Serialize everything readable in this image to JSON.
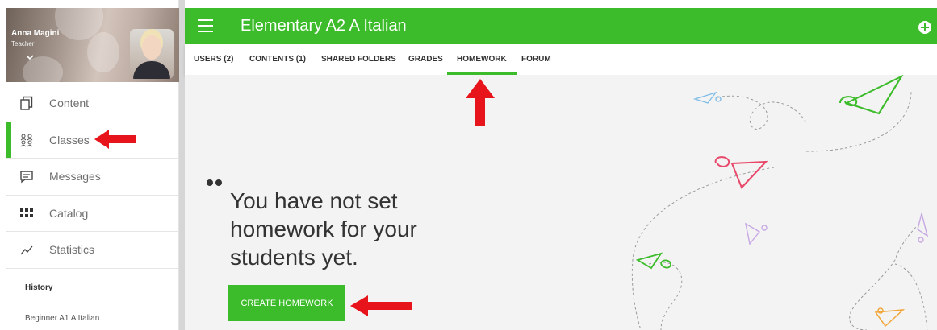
{
  "profile": {
    "name": "Anna Magini",
    "role": "Teacher"
  },
  "sidebar": {
    "items": [
      {
        "label": "Content",
        "icon": "content-icon",
        "active": false
      },
      {
        "label": "Classes",
        "icon": "classes-icon",
        "active": true
      },
      {
        "label": "Messages",
        "icon": "messages-icon",
        "active": false
      },
      {
        "label": "Catalog",
        "icon": "catalog-icon",
        "active": false
      },
      {
        "label": "Statistics",
        "icon": "statistics-icon",
        "active": false
      }
    ],
    "history_title": "History",
    "history_items": [
      "Beginner A1 A Italian"
    ]
  },
  "header": {
    "title": "Elementary A2 A Italian",
    "menu_icon": "hamburger-icon",
    "add_icon": "plus-circle-icon"
  },
  "tabs": [
    {
      "label": "USERS (2)",
      "active": false
    },
    {
      "label": "CONTENTS (1)",
      "active": false
    },
    {
      "label": "SHARED FOLDERS",
      "active": false
    },
    {
      "label": "GRADES",
      "active": false
    },
    {
      "label": "HOMEWORK",
      "active": true
    },
    {
      "label": "FORUM",
      "active": false
    }
  ],
  "main": {
    "empty_message": "You have not set homework for your students yet.",
    "create_button": "CREATE HOMEWORK"
  },
  "colors": {
    "accent": "#3dbc2b",
    "annotation_arrow": "#e8141b",
    "background": "#f3f3f3"
  }
}
